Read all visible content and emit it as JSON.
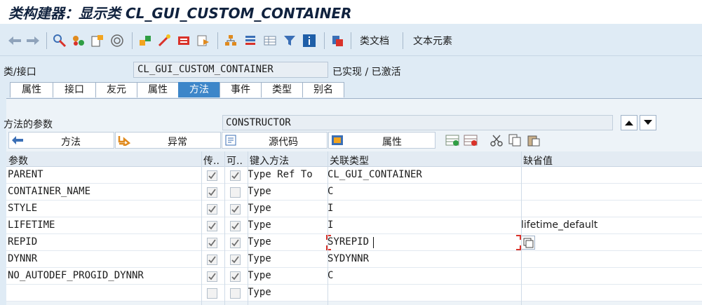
{
  "window_title": "类构建器：显示类 CL_GUI_CUSTOM_CONTAINER",
  "toolbar": {
    "class_docs_label": "类文档",
    "text_elements_label": "文本元素"
  },
  "class_row": {
    "label": "类/接口",
    "value": "CL_GUI_CUSTOM_CONTAINER",
    "status": "已实现 / 已激活"
  },
  "tabs": [
    "属性",
    "接口",
    "友元",
    "属性",
    "方法",
    "事件",
    "类型",
    "别名"
  ],
  "active_tab_index": 4,
  "method_params": {
    "label": "方法的参数",
    "value": "CONSTRUCTOR"
  },
  "subtabs": [
    "方法",
    "异常",
    "源代码",
    "属性"
  ],
  "table": {
    "columns": [
      "参数",
      "传..",
      "可..",
      "键入方法",
      "关联类型",
      "缺省值"
    ],
    "rows": [
      {
        "param": "PARENT",
        "pass": true,
        "optional": true,
        "typing": "Type Ref To",
        "type": "CL_GUI_CONTAINER",
        "default": ""
      },
      {
        "param": "CONTAINER_NAME",
        "pass": true,
        "optional": false,
        "typing": "Type",
        "type": "C",
        "default": ""
      },
      {
        "param": "STYLE",
        "pass": true,
        "optional": true,
        "typing": "Type",
        "type": "I",
        "default": ""
      },
      {
        "param": "LIFETIME",
        "pass": true,
        "optional": true,
        "typing": "Type",
        "type": "I",
        "default": "lifetime_default"
      },
      {
        "param": "REPID",
        "pass": true,
        "optional": true,
        "typing": "Type",
        "type": "SYREPID",
        "default": ""
      },
      {
        "param": "DYNNR",
        "pass": true,
        "optional": true,
        "typing": "Type",
        "type": "SYDYNNR",
        "default": ""
      },
      {
        "param": "NO_AUTODEF_PROGID_DYNNR",
        "pass": true,
        "optional": true,
        "typing": "Type",
        "type": "C",
        "default": ""
      },
      {
        "param": "",
        "pass": false,
        "optional": false,
        "typing": "Type",
        "type": "",
        "default": ""
      }
    ]
  },
  "colors": {
    "background": "#dfebf5",
    "active_tab": "#3d86c9",
    "focus_marker": "#d9322a"
  }
}
